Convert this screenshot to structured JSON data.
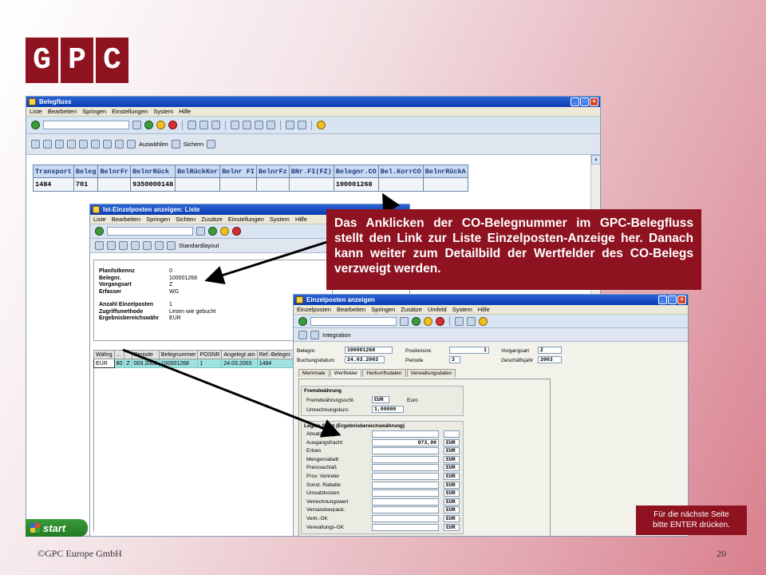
{
  "logo": {
    "letters": [
      "G",
      "P",
      "C"
    ]
  },
  "belegfluss_window": {
    "title": "Belegfluss",
    "menu": [
      "Liste",
      "Bearbeiten",
      "Springen",
      "Einstellungen",
      "System",
      "Hilfe"
    ],
    "toolbar2": {
      "auswaehlen_label": "Auswählen",
      "sichern_label": "Sichern"
    },
    "grid": {
      "columns": [
        "Transport",
        "Beleg",
        "BelnrFr",
        "BelnrRück",
        "BelRückKor",
        "Belnr FI",
        "BelnrFz",
        "BNr.FI(FZ)",
        "Belegnr.CO",
        "Bel.KorrCO",
        "BelnrRückA"
      ],
      "rows": [
        [
          "1484",
          "701",
          "",
          "9350000148",
          "",
          "",
          "",
          "",
          "100001268",
          "",
          ""
        ]
      ]
    }
  },
  "taskbar": {
    "start_label": "start"
  },
  "ist_window": {
    "title": "Ist-Einzelposten anzeigen: Liste",
    "menu": [
      "Liste",
      "Bearbeiten",
      "Springen",
      "Sichten",
      "Zusätze",
      "Einstellungen",
      "System",
      "Hilfe"
    ],
    "toolbar2": {
      "standardlayout_label": "Standardlayout"
    },
    "header": [
      {
        "label": "Plan/Istkennz",
        "value": "0"
      },
      {
        "label": "Belegnr.",
        "value": "100001268"
      },
      {
        "label": "Vorgangsart",
        "value": "Z"
      },
      {
        "label": "Erfasser",
        "value": "WG"
      }
    ],
    "header2": [
      {
        "label": "Anzahl Einzelposten",
        "value": "1"
      },
      {
        "label": "Zugriffsmethode",
        "value": "Lesen wie gebucht"
      },
      {
        "label": "Ergebnisbereichswähr",
        "value": "EUR"
      }
    ],
    "grid": {
      "columns": [
        "Währg",
        "...",
        "",
        "Periode",
        "Belegnummer",
        "POSNR",
        "Angelegt am",
        "Ref.-Belegnr."
      ],
      "row": [
        "EUR",
        "80",
        "Z",
        "003.2003",
        "100001268",
        "1",
        "24.03.2003",
        "1484"
      ]
    }
  },
  "einzelposten_window": {
    "title": "Einzelposten anzeigen",
    "menu": [
      "Einzelposten",
      "Bearbeiten",
      "Springen",
      "Zusätze",
      "Umfeld",
      "System",
      "Hilfe"
    ],
    "toolbar2": {
      "integration_label": "Integration"
    },
    "fields": {
      "belegnr_label": "Belegnr.",
      "belegnr_value": "100001268",
      "positionsnr_label": "Positionsnr.",
      "positionsnr_value": "1",
      "vorgangsart_label": "Vorgangsart",
      "vorgangsart_value": "Z",
      "buchungsdatum_label": "Buchungsdatum",
      "buchungsdatum_value": "24.03.2003",
      "periode_label": "Periode",
      "periode_value": "3",
      "geschaeftsjahr_label": "Geschäftsjahr",
      "geschaeftsjahr_value": "2003"
    },
    "tabs": [
      "Merkmale",
      "Wertfelder",
      "Herkunftsdaten",
      "Verwaltungsdaten"
    ],
    "fremdwaehrung": {
      "title": "Fremdwährung",
      "schl_label": "Fremdwährungsschl.",
      "schl_value": "EUR",
      "schl_text": "Euro",
      "kurs_label": "Umrechnungskurs",
      "kurs_value": "1,00000"
    },
    "legale_sicht": {
      "title": "Legale Sicht (Ergebnisbereichswährung)",
      "rows": [
        {
          "label": "Absatzmenge",
          "value": "",
          "unit": ""
        },
        {
          "label": "Ausgangsfracht",
          "value": "973,00",
          "unit": "EUR"
        },
        {
          "label": "Erloes",
          "value": "",
          "unit": "EUR"
        },
        {
          "label": "Mengenrabatt",
          "value": "",
          "unit": "EUR"
        },
        {
          "label": "Preisnachlaß",
          "value": "",
          "unit": "EUR"
        },
        {
          "label": "Prov. Vertreter",
          "value": "",
          "unit": "EUR"
        },
        {
          "label": "Sonst. Rabatte",
          "value": "",
          "unit": "EUR"
        },
        {
          "label": "Umsatzkosten",
          "value": "",
          "unit": "EUR"
        },
        {
          "label": "Verrechnungswert",
          "value": "",
          "unit": "EUR"
        },
        {
          "label": "Versandverpack.",
          "value": "",
          "unit": "EUR"
        },
        {
          "label": "Vertr.-GK",
          "value": "",
          "unit": "EUR"
        },
        {
          "label": "Verwaltungs-GK",
          "value": "",
          "unit": "EUR"
        }
      ]
    }
  },
  "callout": {
    "text": "Das Anklicken der CO-Belegnummer im GPC-Belegfluss stellt den Link zur Liste Einzelposten-Anzeige her. Danach kann weiter zum Detailbild der Wertfelder des CO-Belegs verzweigt werden."
  },
  "hint": {
    "line1": "Für die nächste Seite",
    "line2": "bitte ENTER drücken."
  },
  "footer": {
    "copyright": "©GPC Europe GmbH",
    "page_number": "20"
  },
  "colors": {
    "brand": "#8e1220",
    "sap_header": "#c9daf2",
    "selected_row": "#9fe0e0"
  }
}
